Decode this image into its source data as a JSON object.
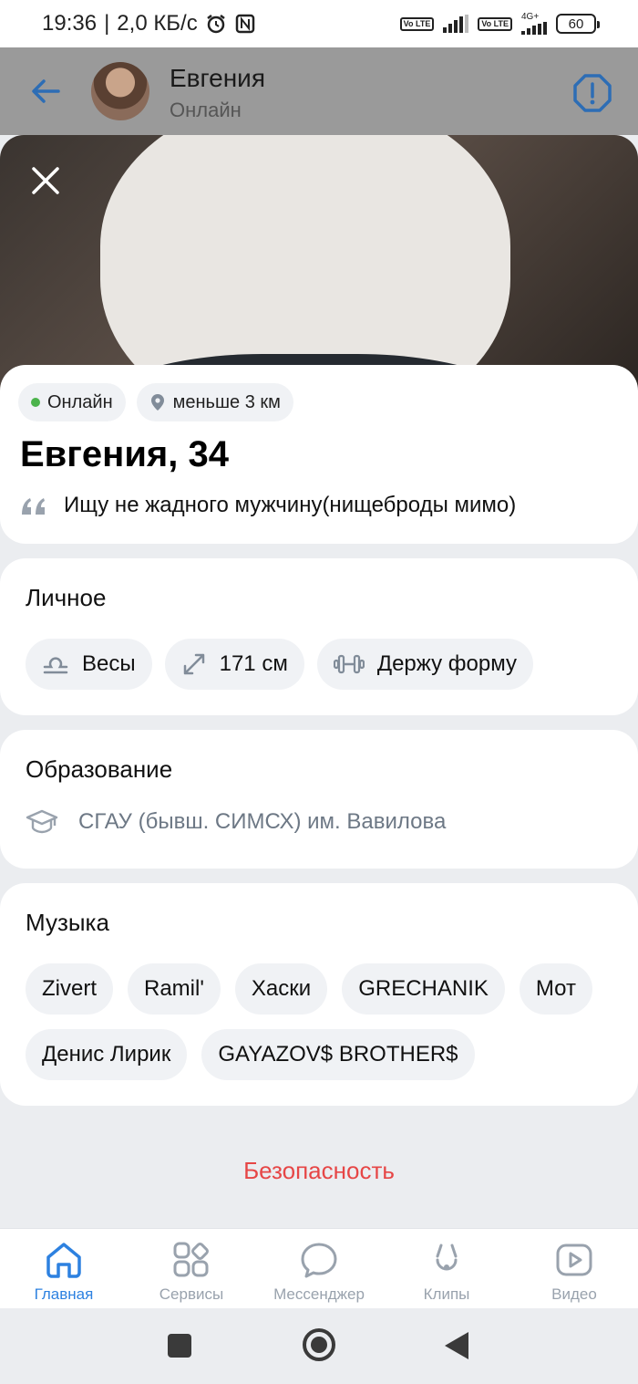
{
  "status_bar": {
    "time": "19:36",
    "speed": "2,0 КБ/с",
    "volte_1": "Vo LTE",
    "volte_2": "Vo LTE",
    "network": "4G+",
    "battery": "60"
  },
  "header": {
    "name": "Евгения",
    "status": "Онлайн"
  },
  "profile": {
    "online_chip": "Онлайн",
    "distance_chip": "меньше 3 км",
    "name_age": "Евгения, 34",
    "bio": "Ищу не жадного мужчину(нищеброды мимо)"
  },
  "personal": {
    "title": "Личное",
    "tags": [
      "Весы",
      "171 см",
      "Держу форму"
    ]
  },
  "education": {
    "title": "Образование",
    "school": "СГАУ (бывш. СИМСХ) им. Вавилова"
  },
  "music": {
    "title": "Музыка",
    "tags": [
      "Zivert",
      "Ramil'",
      "Хаски",
      "GRECHANIK",
      "Мот",
      "Денис Лирик",
      "GAYAZOV$ BROTHER$"
    ]
  },
  "safety_label": "Безопасность",
  "bottom_nav": {
    "items": [
      "Главная",
      "Сервисы",
      "Мессенджер",
      "Клипы",
      "Видео"
    ],
    "active": "Главная",
    "active_color": "#2d81e0"
  }
}
